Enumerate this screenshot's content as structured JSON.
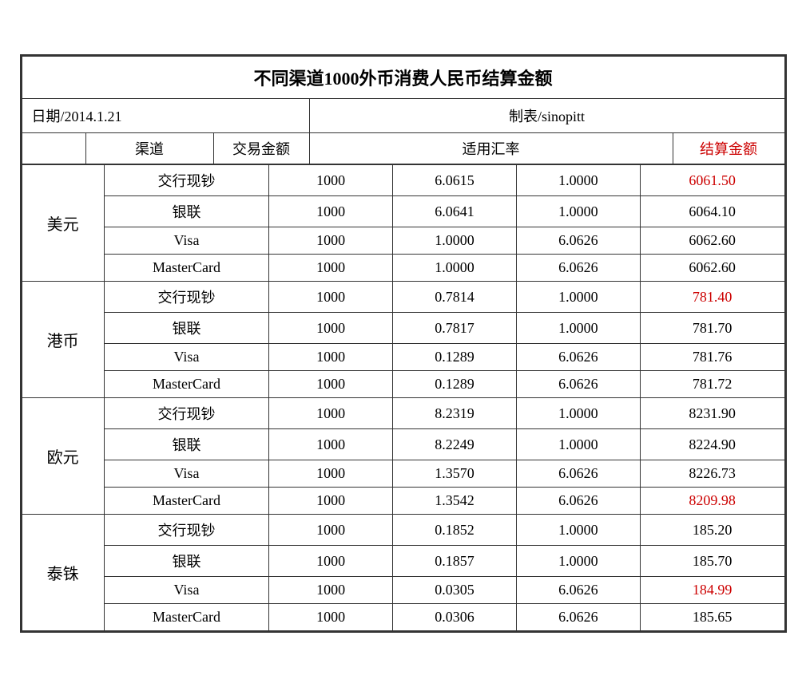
{
  "title": "不同渠道1000外币消费人民币结算金额",
  "date_label": "日期/2014.1.21",
  "maker_label": "制表/sinopitt",
  "headers": {
    "channel": "渠道",
    "amount": "交易金额",
    "rate_label": "适用汇率",
    "settlement": "结算金额"
  },
  "currencies": [
    {
      "name": "美元",
      "rows": [
        {
          "channel": "交行现钞",
          "amount": "1000",
          "rate1": "6.0615",
          "rate2": "1.0000",
          "settlement": "6061.50",
          "red": true
        },
        {
          "channel": "银联",
          "amount": "1000",
          "rate1": "6.0641",
          "rate2": "1.0000",
          "settlement": "6064.10",
          "red": false
        },
        {
          "channel": "Visa",
          "amount": "1000",
          "rate1": "1.0000",
          "rate2": "6.0626",
          "settlement": "6062.60",
          "red": false
        },
        {
          "channel": "MasterCard",
          "amount": "1000",
          "rate1": "1.0000",
          "rate2": "6.0626",
          "settlement": "6062.60",
          "red": false
        }
      ]
    },
    {
      "name": "港币",
      "rows": [
        {
          "channel": "交行现钞",
          "amount": "1000",
          "rate1": "0.7814",
          "rate2": "1.0000",
          "settlement": "781.40",
          "red": true
        },
        {
          "channel": "银联",
          "amount": "1000",
          "rate1": "0.7817",
          "rate2": "1.0000",
          "settlement": "781.70",
          "red": false
        },
        {
          "channel": "Visa",
          "amount": "1000",
          "rate1": "0.1289",
          "rate2": "6.0626",
          "settlement": "781.76",
          "red": false
        },
        {
          "channel": "MasterCard",
          "amount": "1000",
          "rate1": "0.1289",
          "rate2": "6.0626",
          "settlement": "781.72",
          "red": false
        }
      ]
    },
    {
      "name": "欧元",
      "rows": [
        {
          "channel": "交行现钞",
          "amount": "1000",
          "rate1": "8.2319",
          "rate2": "1.0000",
          "settlement": "8231.90",
          "red": false
        },
        {
          "channel": "银联",
          "amount": "1000",
          "rate1": "8.2249",
          "rate2": "1.0000",
          "settlement": "8224.90",
          "red": false
        },
        {
          "channel": "Visa",
          "amount": "1000",
          "rate1": "1.3570",
          "rate2": "6.0626",
          "settlement": "8226.73",
          "red": false
        },
        {
          "channel": "MasterCard",
          "amount": "1000",
          "rate1": "1.3542",
          "rate2": "6.0626",
          "settlement": "8209.98",
          "red": true
        }
      ]
    },
    {
      "name": "泰铢",
      "rows": [
        {
          "channel": "交行现钞",
          "amount": "1000",
          "rate1": "0.1852",
          "rate2": "1.0000",
          "settlement": "185.20",
          "red": false
        },
        {
          "channel": "银联",
          "amount": "1000",
          "rate1": "0.1857",
          "rate2": "1.0000",
          "settlement": "185.70",
          "red": false
        },
        {
          "channel": "Visa",
          "amount": "1000",
          "rate1": "0.0305",
          "rate2": "6.0626",
          "settlement": "184.99",
          "red": true
        },
        {
          "channel": "MasterCard",
          "amount": "1000",
          "rate1": "0.0306",
          "rate2": "6.0626",
          "settlement": "185.65",
          "red": false
        }
      ]
    }
  ]
}
